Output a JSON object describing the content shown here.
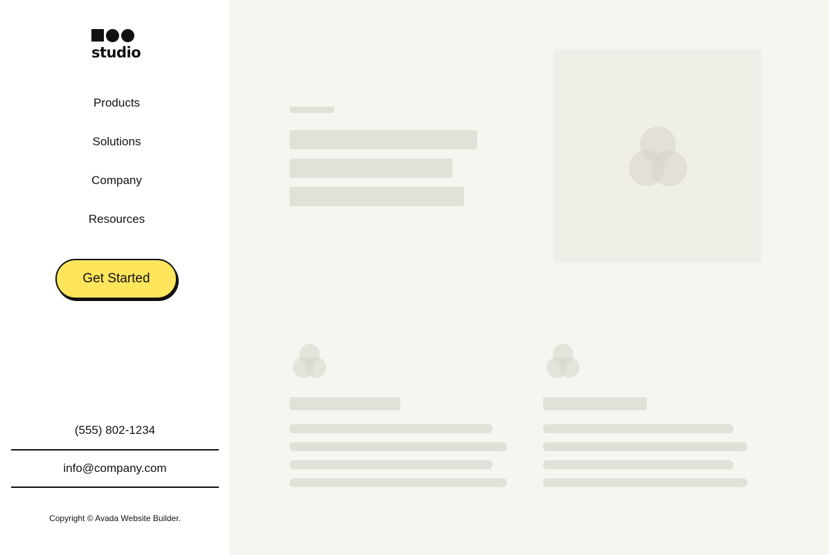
{
  "brand": {
    "logo_text": "studio"
  },
  "nav": {
    "items": [
      {
        "label": "Products"
      },
      {
        "label": "Solutions"
      },
      {
        "label": "Company"
      },
      {
        "label": "Resources"
      }
    ]
  },
  "cta": {
    "label": "Get Started"
  },
  "contact": {
    "phone": "(555) 802-1234",
    "email": "info@company.com"
  },
  "footer": {
    "copyright": "Copyright © Avada Website Builder."
  },
  "colors": {
    "sidebar_bg": "#ffffff",
    "content_bg": "#f6f5f0",
    "cta_bg": "#fde55c",
    "placeholder": "#e2e1d8"
  },
  "icons": [
    "logo-square-circles",
    "image-placeholder-venn-icon"
  ]
}
